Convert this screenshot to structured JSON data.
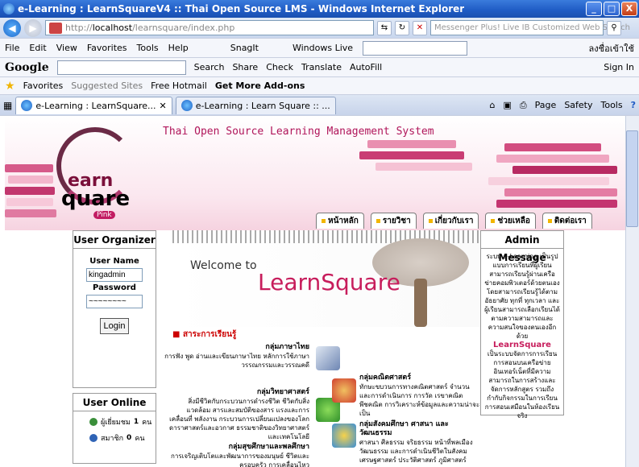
{
  "window": {
    "title": "e-Learning : LearnSquareV4 :: Thai Open Source LMS - Windows Internet Explorer",
    "btn_min": "_",
    "btn_max": "□",
    "btn_close": "X"
  },
  "address": {
    "back": "◀",
    "forward": "▶",
    "url_prefix": "http://",
    "url_host": "localhost",
    "url_path": "/learnsquare/index.php",
    "search_placeholder": "Messenger Plus! Live IB Customized Web Search"
  },
  "menu": {
    "items": [
      "File",
      "Edit",
      "View",
      "Favorites",
      "Tools",
      "Help"
    ],
    "snagit": "SnagIt",
    "windows_live": "Windows Live",
    "signin_thai": "ลงชื่อเข้าใช้"
  },
  "google": {
    "logo": "Google",
    "search": "Search",
    "share": "Share",
    "check": "Check",
    "translate": "Translate",
    "autofill": "AutoFill",
    "signin": "Sign In"
  },
  "favorites": {
    "label": "Favorites",
    "items": [
      "Suggested Sites",
      "Free Hotmail",
      "Get More Add-ons"
    ]
  },
  "tabs": {
    "items": [
      "e-Learning : LearnSquare...",
      "e-Learning : Learn Square :: ..."
    ],
    "tools": [
      "Page",
      "Safety",
      "Tools"
    ]
  },
  "site": {
    "slogan": "Thai Open Source Learning Management System",
    "logo_earn": "earn",
    "logo_square": "quare",
    "logo_pink": "Pink",
    "nav": [
      "หน้าหลัก",
      "รายวิชา",
      "เกี่ยวกับเรา",
      "ช่วยเหลือ",
      "ติดต่อเรา"
    ],
    "user_organizer": "User Organizer",
    "username_label": "User Name",
    "username_value": "kingadmin",
    "password_label": "Password",
    "password_value": "~~~~~~~~",
    "login_button": "Login",
    "user_online": "User Online",
    "online_members_label": "ผู้เยี่ยมชม",
    "online_members_count": "1",
    "online_members_unit": "คน",
    "online_users_label": "สมาชิก",
    "online_users_count": "0",
    "online_users_unit": "คน",
    "welcome_to": "Welcome to",
    "welcome_brand": "LearnSquare",
    "section_title": "สาระการเรียนรู้",
    "admin_message": "Admin Message",
    "admin_text_1": "ระบบ e-Learning เป็นรูปแบบการเรียนที่ผู้เรียนสามารถเรียนรู้ผ่านเครือข่ายคอมพิวเตอร์ด้วยตนเอง โดยสามารถเรียนรู้ได้ตามอัธยาศัย ทุกที่ ทุกเวลา และผู้เรียนสามารถเลือกเรียนได้ตามความสามารถและความสนใจของตนเองอีกด้วย",
    "admin_brand": "LearnSquare",
    "admin_text_2": "เป็นระบบจัดการการเรียนการสอนบนเครือข่ายอินเทอร์เน็ตที่มีความสามารถในการสร้างและจัดการหลักสูตร รวมถึงกำกับกิจกรรมในการเรียนการสอนเสมือนในห้องเรียนจริง",
    "categories": [
      {
        "title": "กลุ่มภาษาไทย",
        "desc": "การฟัง พูด อ่านและเขียนภาษาไทย หลักการใช้ภาษา วรรณกรรมและวรรณคดี"
      },
      {
        "title": "กลุ่มคณิตศาสตร์",
        "desc": "ทักษะขบวนการทางคณิตศาสตร์ จำนวนและการดำเนินการ การวัด เรขาคณิต พีชคณิต การวิเคราะห์ข้อมูลและความน่าจะเป็น"
      },
      {
        "title": "กลุ่มวิทยาศาสตร์",
        "desc": "สิ่งมีชีวิตกับกระบวนการดำรงชีวิต ชีวิตกับสิ่งแวดล้อม สารและสมบัติของสาร แรงและการเคลื่อนที่ พลังงาน กระบวนการเปลี่ยนแปลงของโลก ดาราศาสตร์และอวกาศ ธรรมชาติของวิทยาศาสตร์และเทคโนโลยี"
      },
      {
        "title": "กลุ่มสังคมศึกษา ศาสนา และวัฒนธรรม",
        "desc": "ศาสนา ศีลธรรม จริยธรรม หน้าที่พลเมือง วัฒนธรรม และการดำเนินชีวิตในสังคม เศรษฐศาสตร์ ประวัติศาสตร์ ภูมิศาสตร์"
      },
      {
        "title": "กลุ่มสุขศึกษาและพลศึกษา",
        "desc": "การเจริญเติบโตและพัฒนาการของมนุษย์ ชีวิตและครอบครัว การเคลื่อนไหว"
      }
    ]
  },
  "colors": {
    "brand": "#c71d5c",
    "title_bar": "#1f5bc4"
  }
}
